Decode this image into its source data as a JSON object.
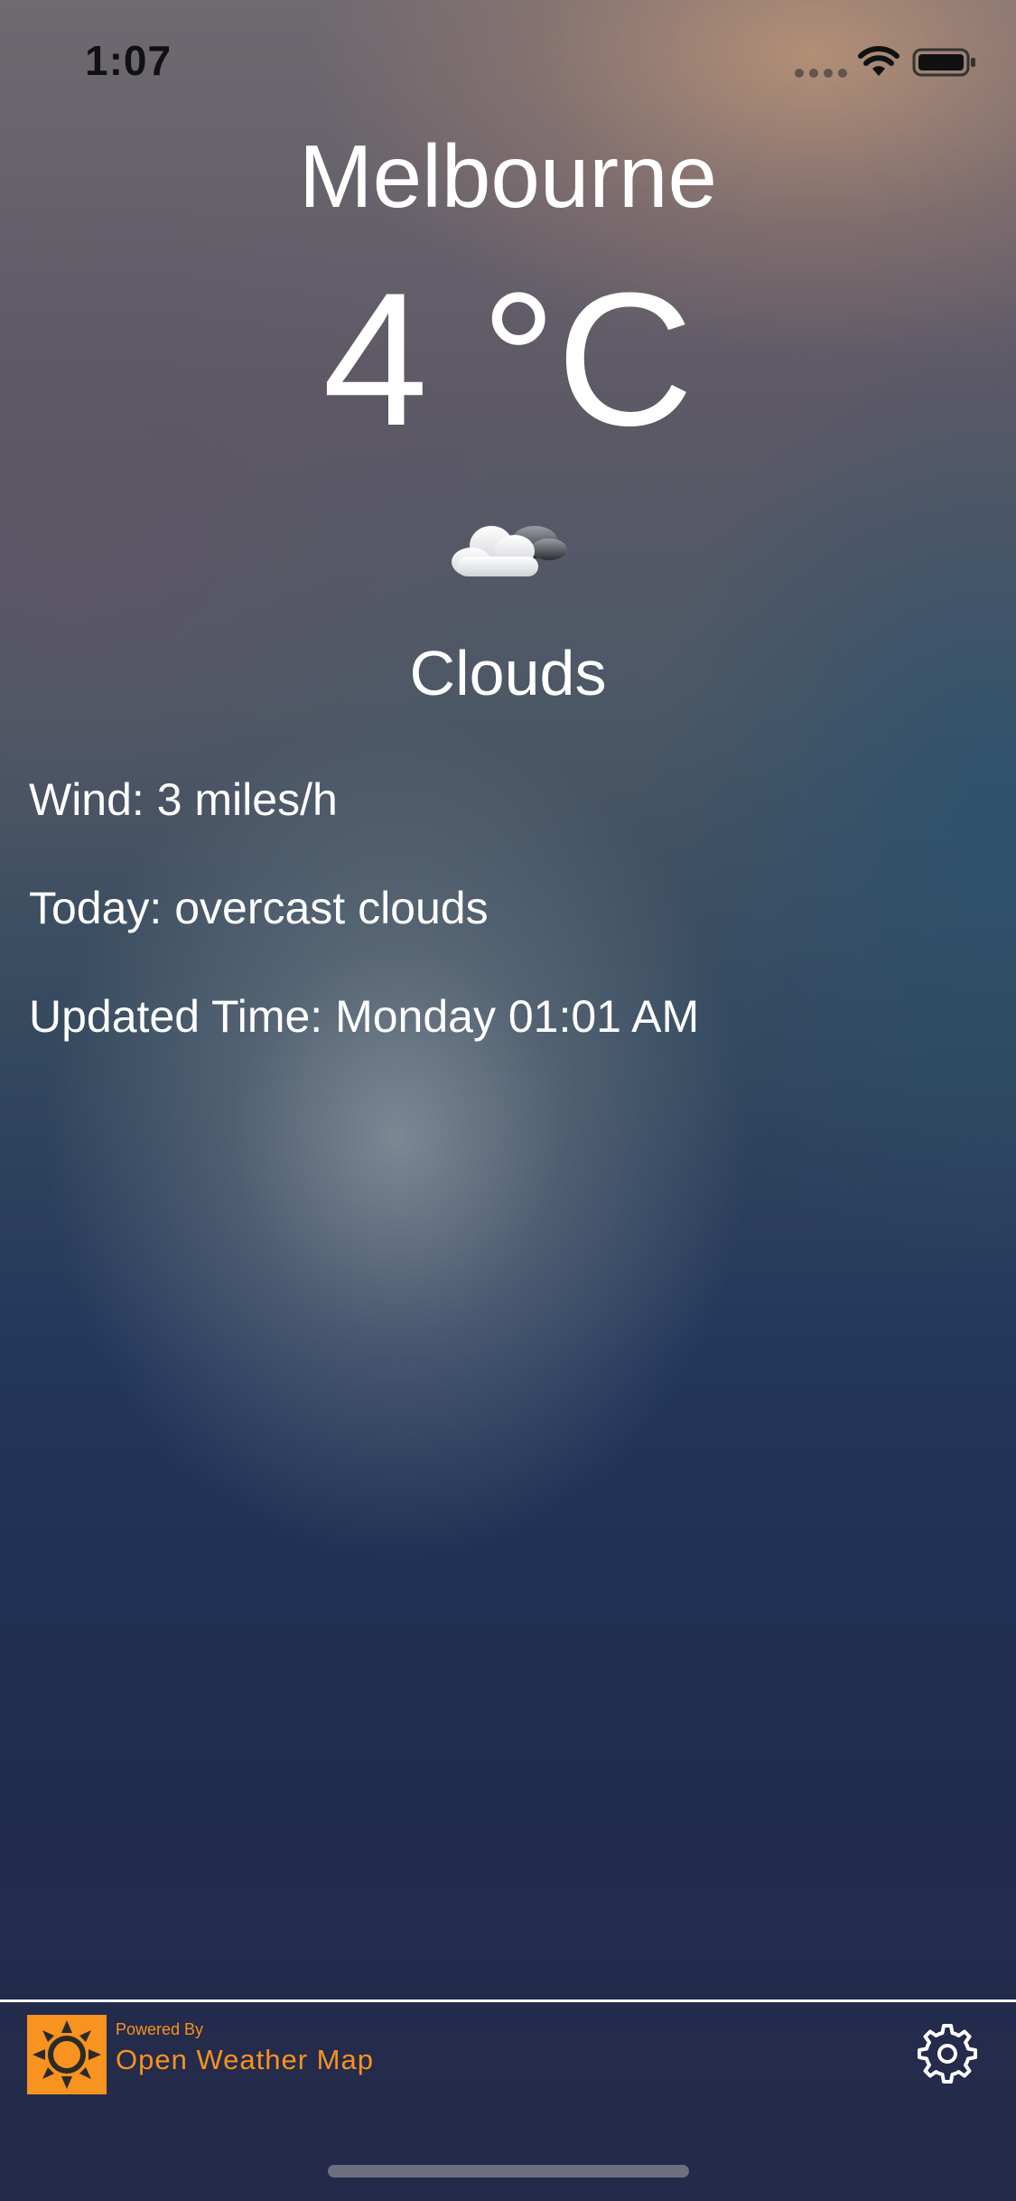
{
  "status_bar": {
    "time": "1:07"
  },
  "weather": {
    "city": "Melbourne",
    "temperature": "4 °C",
    "condition_icon": "cloud-icon",
    "condition": "Clouds",
    "wind": "Wind: 3 miles/h",
    "today": "Today: overcast clouds",
    "updated": "Updated Time: Monday 01:01 AM"
  },
  "footer": {
    "powered_by": "Powered By",
    "provider_name": "Open Weather Map",
    "provider_logo_icon": "sun-icon",
    "settings_icon": "gear-icon"
  },
  "colors": {
    "brand_orange": "#f7931e",
    "text": "#ffffff"
  }
}
